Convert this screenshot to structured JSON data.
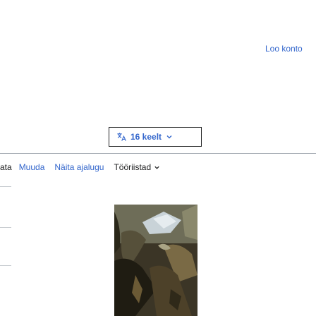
{
  "header": {
    "create_account_label": "Loo konto"
  },
  "language_button": {
    "label": "16 keelt",
    "icon": "translate-icon"
  },
  "tabs": [
    {
      "label": "ata"
    },
    {
      "label": "Muuda"
    },
    {
      "label": "Näita ajalugu"
    },
    {
      "label": "Tööriistad",
      "icon": "chevron-down-icon"
    }
  ],
  "colors": {
    "link": "#3366cc",
    "text": "#202122",
    "divider": "#a2a9b1"
  }
}
